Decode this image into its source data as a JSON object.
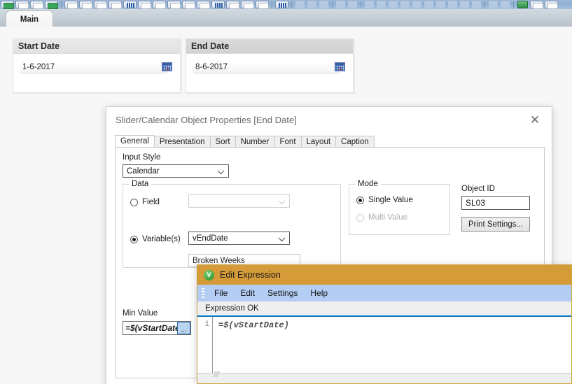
{
  "toolbar": {
    "name": "qlikview-toolbar"
  },
  "sheet_tabs": {
    "active": "Main"
  },
  "date_panels": [
    {
      "caption": "Start Date",
      "value": "1-6-2017",
      "icon": "calendar-icon"
    },
    {
      "caption": "End Date",
      "value": "8-6-2017",
      "icon": "calendar-icon"
    }
  ],
  "properties_dialog": {
    "title": "Slider/Calendar Object Properties [End Date]",
    "close_label": "✕",
    "tabs": [
      {
        "label": "General",
        "active": true
      },
      {
        "label": "Presentation",
        "active": false
      },
      {
        "label": "Sort",
        "active": false
      },
      {
        "label": "Number",
        "active": false
      },
      {
        "label": "Font",
        "active": false
      },
      {
        "label": "Layout",
        "active": false
      },
      {
        "label": "Caption",
        "active": false
      }
    ],
    "input_style": {
      "label": "Input Style",
      "value": "Calendar"
    },
    "data_group": {
      "legend": "Data",
      "field_radio": {
        "label": "Field",
        "checked": false
      },
      "field_combo_value": "",
      "variable_radio": {
        "label": "Variable(s)",
        "checked": true
      },
      "variable_combo_value": "vEndDate",
      "obscured_combo_value": "Broken Weeks"
    },
    "mode_group": {
      "legend": "Mode",
      "single": {
        "label": "Single Value",
        "checked": true,
        "disabled": false
      },
      "multi": {
        "label": "Multi Value",
        "checked": false,
        "disabled": true
      }
    },
    "object_id": {
      "label": "Object ID",
      "value": "SL03"
    },
    "print_settings_button": "Print Settings...",
    "min_value": {
      "label": "Min Value",
      "value": "=$(vStartDate)",
      "ellipsis_label": "..."
    }
  },
  "expression_dialog": {
    "title": "Edit Expression",
    "logo_letter": "V",
    "menu": [
      "File",
      "Edit",
      "Settings",
      "Help"
    ],
    "status": "Expression OK",
    "line_number": "1",
    "code": "=$(vStartDate)"
  },
  "colors": {
    "expr_title_bg": "#d59b38",
    "expr_menu_bg": "#b3cdf4",
    "expr_accent": "#0a78c8",
    "toolbar_bg": "#8fb0d4",
    "tabbar_bg": "#c5ced6",
    "canvas_bg": "#f7f7f7"
  }
}
